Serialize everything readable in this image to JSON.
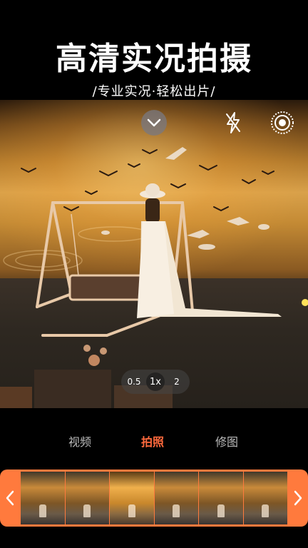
{
  "header": {
    "title": "高清实况拍摄",
    "subtitle": "/专业实况·轻松出片/"
  },
  "camera": {
    "zoom_options": [
      "0.5",
      "1x",
      "2"
    ],
    "zoom_current": "1x"
  },
  "modes": {
    "items": [
      {
        "label": "视频"
      },
      {
        "label": "拍照"
      },
      {
        "label": "修图"
      }
    ],
    "active": "拍照"
  },
  "strip": {
    "frame_count": 6,
    "selected_frame": 3
  },
  "colors": {
    "accent": "#ff6a3d",
    "strip": "#ff7a3d"
  }
}
